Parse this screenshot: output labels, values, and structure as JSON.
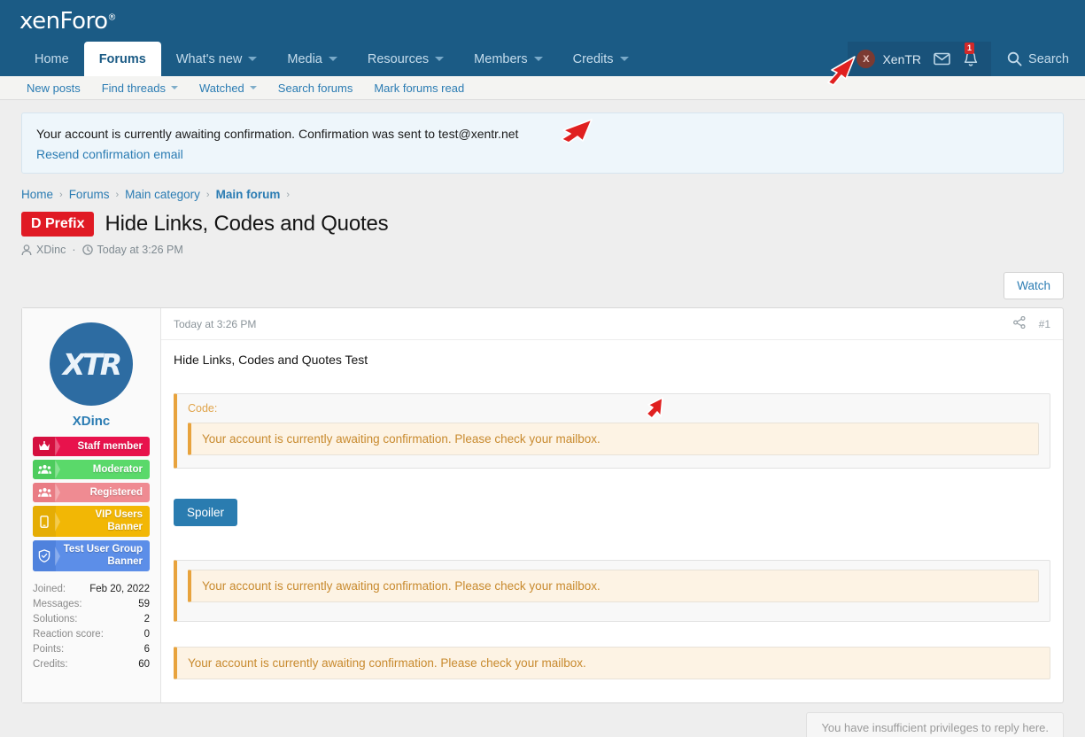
{
  "site": {
    "logo": "xenForo",
    "logo_mark": "®"
  },
  "nav": {
    "items": [
      {
        "label": "Home",
        "has_caret": false,
        "selected": false
      },
      {
        "label": "Forums",
        "has_caret": false,
        "selected": true
      },
      {
        "label": "What's new",
        "has_caret": true,
        "selected": false
      },
      {
        "label": "Media",
        "has_caret": true,
        "selected": false
      },
      {
        "label": "Resources",
        "has_caret": true,
        "selected": false
      },
      {
        "label": "Members",
        "has_caret": true,
        "selected": false
      },
      {
        "label": "Credits",
        "has_caret": true,
        "selected": false
      }
    ],
    "account": {
      "username": "XenTR",
      "avatar_letter": "X",
      "inbox_icon": "envelope-icon",
      "alerts_icon": "bell-icon",
      "alerts_count": "1"
    },
    "search": {
      "label": "Search",
      "icon": "search-icon"
    }
  },
  "subnav": {
    "items": [
      {
        "label": "New posts",
        "has_caret": false
      },
      {
        "label": "Find threads",
        "has_caret": true
      },
      {
        "label": "Watched",
        "has_caret": true
      },
      {
        "label": "Search forums",
        "has_caret": false
      },
      {
        "label": "Mark forums read",
        "has_caret": false
      }
    ]
  },
  "notice": {
    "text": "Your account is currently awaiting confirmation. Confirmation was sent to test@xentr.net",
    "link": "Resend confirmation email"
  },
  "breadcrumb": {
    "items": [
      {
        "label": "Home",
        "strong": false
      },
      {
        "label": "Forums",
        "strong": false
      },
      {
        "label": "Main category",
        "strong": false
      },
      {
        "label": "Main forum",
        "strong": true
      }
    ],
    "separator": "›"
  },
  "thread": {
    "prefix": "D Prefix",
    "prefix_color": "#e01a24",
    "title": "Hide Links, Codes and Quotes",
    "author": "XDinc",
    "author_icon": "user-icon",
    "date_icon": "clock-icon",
    "date": "Today at 3:26 PM",
    "separator": "·"
  },
  "actions": {
    "watch_label": "Watch"
  },
  "post": {
    "date": "Today at 3:26 PM",
    "share_icon": "share-icon",
    "number": "#1",
    "text": "Hide Links, Codes and Quotes Test",
    "code": {
      "label": "Code:",
      "content": "Your account is currently awaiting confirmation. Please check your mailbox."
    },
    "spoiler_label": "Spoiler",
    "quote": {
      "content": "Your account is currently awaiting confirmation. Please check your mailbox."
    },
    "bare_alert": "Your account is currently awaiting confirmation. Please check your mailbox."
  },
  "author_card": {
    "username": "XDinc",
    "avatar_text": "XTR",
    "banners": [
      {
        "label": "Staff member",
        "icon": "crown-icon",
        "bg": "#e8124c",
        "icon_bg": "#d5103f"
      },
      {
        "label": "Moderator",
        "icon": "users-icon",
        "bg": "#5ad96a",
        "icon_bg": "#4dcc5d"
      },
      {
        "label": "Registered",
        "icon": "users-icon",
        "bg": "#ef8b92",
        "icon_bg": "#e97c84"
      },
      {
        "label": "VIP Users Banner",
        "icon": "mobile-icon",
        "bg": "#f2b705",
        "icon_bg": "#e5ad04"
      },
      {
        "label": "Test User Group Banner",
        "icon": "shield-icon",
        "bg": "#5c8ee8",
        "icon_bg": "#4f82dd"
      }
    ],
    "stats": [
      {
        "key": "Joined:",
        "value": "Feb 20, 2022"
      },
      {
        "key": "Messages:",
        "value": "59"
      },
      {
        "key": "Solutions:",
        "value": "2"
      },
      {
        "key": "Reaction score:",
        "value": "0"
      },
      {
        "key": "Points:",
        "value": "6"
      },
      {
        "key": "Credits:",
        "value": "60"
      }
    ]
  },
  "footer": {
    "reply_note": "You have insufficient privileges to reply here."
  }
}
